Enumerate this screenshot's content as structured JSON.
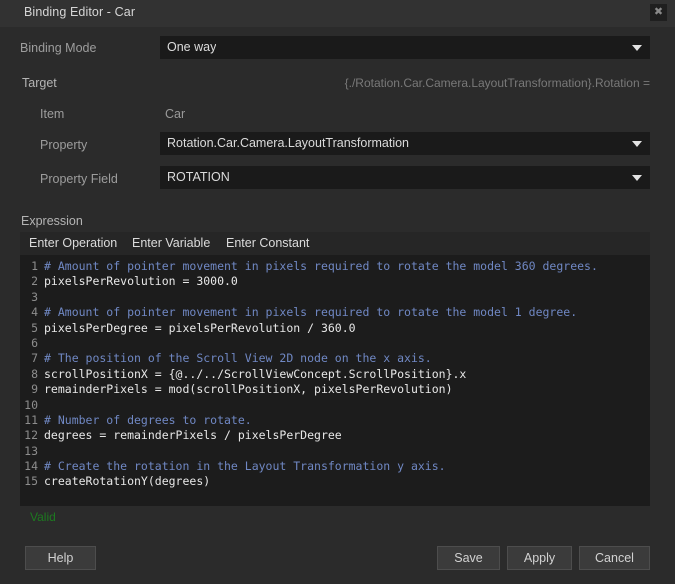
{
  "window": {
    "title": "Binding Editor - Car",
    "close_icon": "close-icon",
    "close_label": "✖"
  },
  "form": {
    "binding_mode": {
      "label": "Binding Mode",
      "value": "One way",
      "arrow_icon": "chevron-down-icon"
    },
    "target": {
      "section_label": "Target",
      "path": "{./Rotation.Car.Camera.LayoutTransformation}.Rotation =",
      "item": {
        "label": "Item",
        "value": "Car"
      },
      "property": {
        "label": "Property",
        "value": "Rotation.Car.Camera.LayoutTransformation",
        "arrow_icon": "chevron-down-icon"
      },
      "property_field": {
        "label": "Property Field",
        "value": "ROTATION",
        "arrow_icon": "chevron-down-icon"
      }
    }
  },
  "expression": {
    "section_label": "Expression",
    "toolbar": [
      {
        "label": "Enter Operation"
      },
      {
        "label": "Enter Variable"
      },
      {
        "label": "Enter Constant"
      }
    ],
    "lines": [
      {
        "n": "1",
        "text": "# Amount of pointer movement in pixels required to rotate the model 360 degrees.",
        "kind": "comment"
      },
      {
        "n": "2",
        "text": "pixelsPerRevolution = 3000.0",
        "kind": "code"
      },
      {
        "n": "3",
        "text": "",
        "kind": "code"
      },
      {
        "n": "4",
        "text": "# Amount of pointer movement in pixels required to rotate the model 1 degree.",
        "kind": "comment"
      },
      {
        "n": "5",
        "text": "pixelsPerDegree = pixelsPerRevolution / 360.0",
        "kind": "code"
      },
      {
        "n": "6",
        "text": "",
        "kind": "code"
      },
      {
        "n": "7",
        "text": "# The position of the Scroll View 2D node on the x axis.",
        "kind": "comment"
      },
      {
        "n": "8",
        "text": "scrollPositionX = {@../../ScrollViewConcept.ScrollPosition}.x",
        "kind": "code"
      },
      {
        "n": "9",
        "text": "remainderPixels = mod(scrollPositionX, pixelsPerRevolution)",
        "kind": "code"
      },
      {
        "n": "10",
        "text": "",
        "kind": "code"
      },
      {
        "n": "11",
        "text": "# Number of degrees to rotate.",
        "kind": "comment"
      },
      {
        "n": "12",
        "text": "degrees = remainderPixels / pixelsPerDegree",
        "kind": "code"
      },
      {
        "n": "13",
        "text": "",
        "kind": "code"
      },
      {
        "n": "14",
        "text": "# Create the rotation in the Layout Transformation y axis.",
        "kind": "comment"
      },
      {
        "n": "15",
        "text": "createRotationY(degrees)",
        "kind": "code"
      }
    ],
    "status": "Valid",
    "status_color": "#1d7a20"
  },
  "footer": {
    "help": "Help",
    "save": "Save",
    "apply": "Apply",
    "cancel": "Cancel"
  }
}
